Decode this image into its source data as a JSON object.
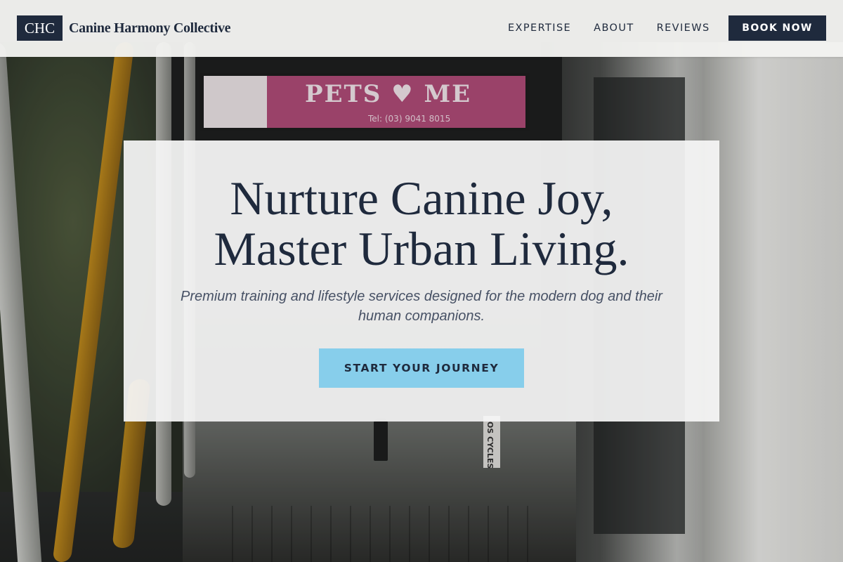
{
  "header": {
    "brand_mark": "CHC",
    "brand_name": "Canine Harmony Collective",
    "nav": [
      "EXPERTISE",
      "ABOUT",
      "REVIEWS"
    ],
    "book_button": "BOOK NOW"
  },
  "hero": {
    "title_line1": "Nurture Canine Joy,",
    "title_line2": "Master Urban Living.",
    "subtitle": "Premium training and lifestyle services designed for the modern dog and their human companions.",
    "cta": "START YOUR JOURNEY"
  },
  "background": {
    "sign_text": "PETS ♥ ME",
    "sign_tel": "Tel: (03) 9041 8015",
    "cycles_text": "OS CYCLES"
  },
  "colors": {
    "navy": "#1f2a3d",
    "sky_blue": "#87ceeb",
    "subtitle_gray": "#475165"
  }
}
